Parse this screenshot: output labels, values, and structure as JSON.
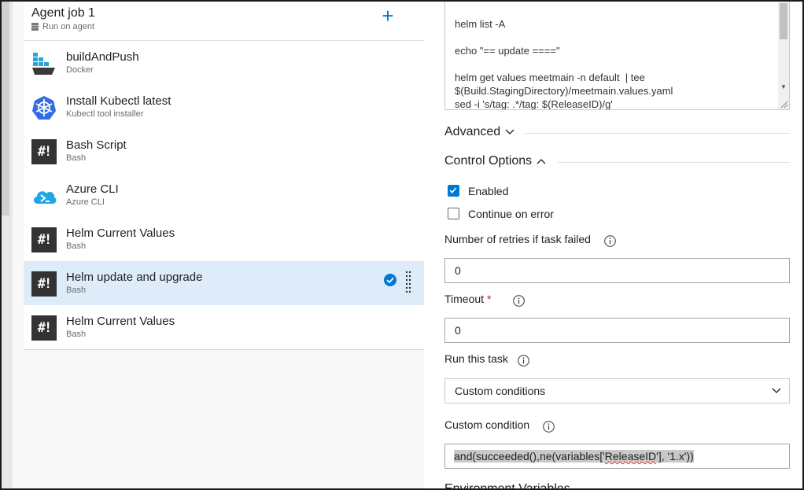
{
  "agent_job": {
    "title": "Agent job 1",
    "subtitle": "Run on agent",
    "add_label": "+"
  },
  "tasks": [
    {
      "name": "buildAndPush",
      "sub": "Docker",
      "icon": "docker-icon"
    },
    {
      "name": "Install Kubectl latest",
      "sub": "Kubectl tool installer",
      "icon": "kubernetes-icon"
    },
    {
      "name": "Bash Script",
      "sub": "Bash",
      "icon": "bash-icon"
    },
    {
      "name": "Azure CLI",
      "sub": "Azure CLI",
      "icon": "azure-cli-icon"
    },
    {
      "name": "Helm Current Values",
      "sub": "Bash",
      "icon": "bash-icon"
    },
    {
      "name": "Helm update and upgrade",
      "sub": "Bash",
      "icon": "bash-icon",
      "selected": true
    },
    {
      "name": "Helm Current Values",
      "sub": "Bash",
      "icon": "bash-icon"
    }
  ],
  "bash_glyph": "#!",
  "script": {
    "lines": [
      "helm list -A",
      "echo \"== update ====\"",
      "helm get values meetmain -n default  | tee",
      "$(Build.StagingDirectory)/meetmain.values.yaml",
      "sed -i 's/tag: .*/tag: $(ReleaseID)/g'"
    ]
  },
  "sections": {
    "advanced": "Advanced",
    "control_options": "Control Options",
    "environment_variables": "Environment Variables"
  },
  "control": {
    "enabled_label": "Enabled",
    "enabled_checked": true,
    "continue_label": "Continue on error",
    "continue_checked": false,
    "retries_label": "Number of retries if task failed",
    "retries_value": "0",
    "timeout_label": "Timeout",
    "timeout_required": "*",
    "timeout_value": "0",
    "run_label": "Run this task",
    "run_value": "Custom conditions",
    "condition_label": "Custom condition",
    "condition_pre": "and(succeeded(),ne(variables['",
    "condition_var": "ReleaseID",
    "condition_post": "'], '1.x'))"
  },
  "colors": {
    "accent": "#0078d4",
    "selected_row": "#deecf9"
  }
}
